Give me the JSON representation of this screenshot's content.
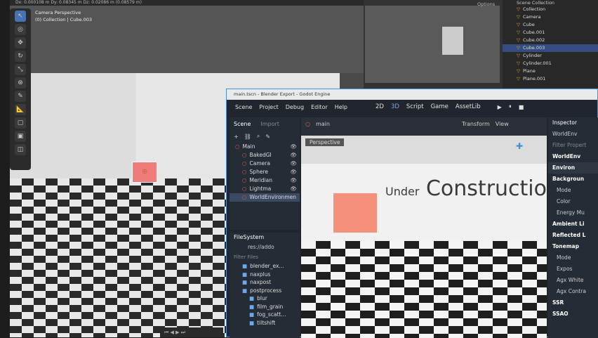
{
  "blender": {
    "viewport_header": "Dx: 0.000108 m   Dy: 0.08345 m   Dz: 0.02086 m (0.08579 m)",
    "viewport_label": "Camera Perspective",
    "viewport_sublabel": "(0) Collection | Cube.003",
    "mini_options": "Options",
    "outliner_title": "Scene Collection",
    "outliner_items": [
      {
        "label": "Collection",
        "selected": false
      },
      {
        "label": "Camera",
        "selected": false
      },
      {
        "label": "Cube",
        "selected": false
      },
      {
        "label": "Cube.001",
        "selected": false
      },
      {
        "label": "Cube.002",
        "selected": false
      },
      {
        "label": "Cube.003",
        "selected": true
      },
      {
        "label": "Cylinder",
        "selected": false
      },
      {
        "label": "Cylinder.001",
        "selected": false
      },
      {
        "label": "Plane",
        "selected": false
      },
      {
        "label": "Plane.001",
        "selected": false
      }
    ]
  },
  "godot": {
    "title": "main.tscn - Blender Export - Godot Engine",
    "menus": [
      "Scene",
      "Project",
      "Debug",
      "Editor",
      "Help"
    ],
    "workspaces": [
      {
        "label": "2D",
        "active": false
      },
      {
        "label": "3D",
        "active": true
      },
      {
        "label": "Script",
        "active": false
      },
      {
        "label": "Game",
        "active": false
      },
      {
        "label": "AssetLib",
        "active": false
      }
    ],
    "scene_tab": "Scene",
    "import_tab": "Import",
    "main_tab": "main",
    "tree": [
      {
        "label": "Main",
        "selected": false
      },
      {
        "label": "BakedGI",
        "selected": false
      },
      {
        "label": "Camera",
        "selected": false
      },
      {
        "label": "Sphere",
        "selected": false
      },
      {
        "label": "Meridian",
        "selected": false
      },
      {
        "label": "Lightma",
        "selected": false
      },
      {
        "label": "WorldEnvironmen",
        "selected": true
      }
    ],
    "filesystem_title": "FileSystem",
    "path": "res://addo",
    "filter_placeholder": "Filter Files",
    "fs_items": [
      "blender_ex...",
      "naxplus",
      "naxpost",
      "postprocess",
      "blur",
      "film_grain",
      "fog_scatt...",
      "tiltshift"
    ],
    "viewport_label": "Perspective",
    "transform_label": "Transform",
    "view_label": "View",
    "scene_text_small": "Under",
    "scene_text_big": "Construction",
    "inspector_title": "Inspector",
    "inspector_node": "WorldEnv",
    "inspector_filter": "Filter Propert",
    "inspector_res": "WorldEnv",
    "inspector_rows": [
      {
        "label": "Environ",
        "kind": "sec"
      },
      {
        "label": "Backgroun",
        "kind": "hdr"
      },
      {
        "label": "Mode",
        "kind": "row"
      },
      {
        "label": "Color",
        "kind": "row"
      },
      {
        "label": "Energy Mu",
        "kind": "row"
      },
      {
        "label": "Ambient Li",
        "kind": "hdr"
      },
      {
        "label": "Reflected L",
        "kind": "hdr"
      },
      {
        "label": "Tonemap",
        "kind": "hdr"
      },
      {
        "label": "Mode",
        "kind": "row"
      },
      {
        "label": "Expos",
        "kind": "row"
      },
      {
        "label": "Agx White",
        "kind": "row"
      },
      {
        "label": "Agx Contra",
        "kind": "row"
      },
      {
        "label": "SSR",
        "kind": "hdr"
      },
      {
        "label": "SSAO",
        "kind": "hdr"
      }
    ]
  }
}
